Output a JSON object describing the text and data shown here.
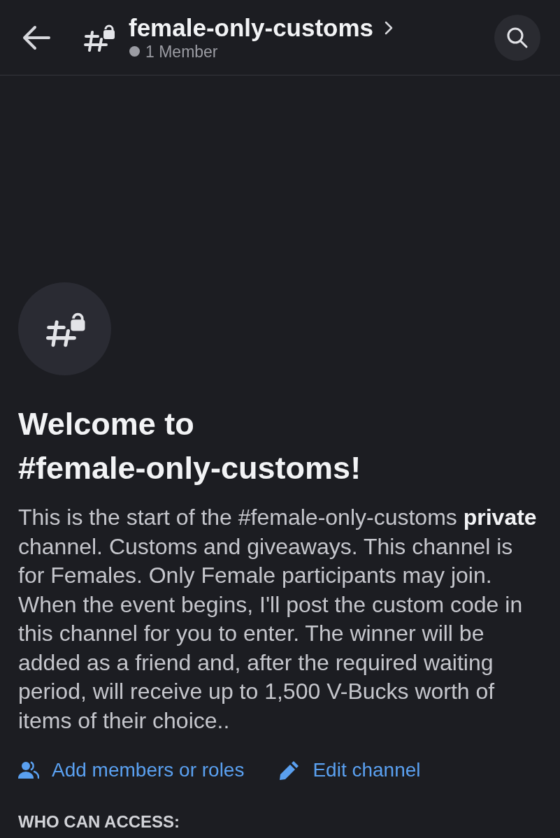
{
  "header": {
    "channel_name": "female-only-customs",
    "member_count": "1 Member"
  },
  "welcome": {
    "title": "Welcome to #female-only-customs!",
    "description": "This is the start of the #female-only-customs **private** channel. Customs and giveaways. This channel is for Females. Only Female participants may join. When the event begins, I'll post the custom code in this channel for you to enter. The winner will be added as a friend and, after the required waiting period, will receive up to 1,500 V-Bucks worth of items of their choice.."
  },
  "actions": [
    {
      "kind": "add-members",
      "label": "Add members or roles"
    },
    {
      "kind": "edit",
      "label": "Edit channel"
    }
  ],
  "access": {
    "heading": "WHO CAN ACCESS:"
  }
}
